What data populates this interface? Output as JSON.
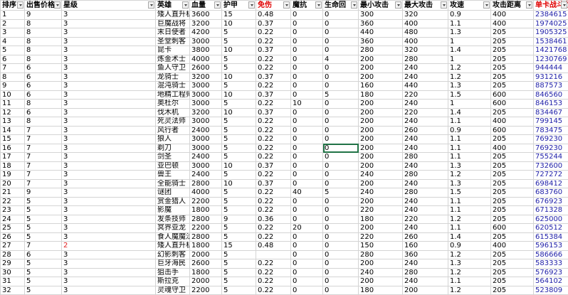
{
  "headers": [
    "排序",
    "出售价格",
    "星级",
    "英雄",
    "血量",
    "护甲",
    "免伤",
    "魔抗",
    "生命回",
    "最小攻击",
    "最大攻击",
    "攻速",
    "攻击距离",
    "单卡战斗力"
  ],
  "rows": [
    [
      "1",
      "9",
      "3",
      "矮人直升机",
      "3600",
      "15",
      "0.48",
      "0",
      "0",
      "300",
      "320",
      "0.9",
      "400",
      "2384615"
    ],
    [
      "2",
      "8",
      "3",
      "巨魔战将",
      "3200",
      "10",
      "0.37",
      "0",
      "0",
      "360",
      "400",
      "1.1",
      "400",
      "1974025"
    ],
    [
      "3",
      "8",
      "3",
      "末日使者",
      "4200",
      "5",
      "0.22",
      "0",
      "0",
      "440",
      "480",
      "1.3",
      "205",
      "1905325"
    ],
    [
      "4",
      "8",
      "3",
      "圣堂刺客",
      "3000",
      "5",
      "0.22",
      "0",
      "0",
      "360",
      "400",
      "1",
      "205",
      "1538461"
    ],
    [
      "5",
      "8",
      "3",
      "昆卡",
      "3800",
      "10",
      "0.37",
      "0",
      "0",
      "280",
      "320",
      "1.4",
      "205",
      "1421768"
    ],
    [
      "6",
      "8",
      "3",
      "炼金术士",
      "4000",
      "5",
      "0.22",
      "0",
      "4",
      "200",
      "280",
      "1",
      "205",
      "1230769"
    ],
    [
      "7",
      "6",
      "3",
      "鱼人守卫",
      "2600",
      "5",
      "0.22",
      "0",
      "0",
      "200",
      "240",
      "1.2",
      "205",
      "944444"
    ],
    [
      "8",
      "6",
      "3",
      "龙骑士",
      "3200",
      "10",
      "0.37",
      "0",
      "0",
      "200",
      "240",
      "1.2",
      "205",
      "931216"
    ],
    [
      "9",
      "6",
      "3",
      "混沌骑士",
      "3000",
      "5",
      "0.22",
      "0",
      "0",
      "160",
      "440",
      "1.3",
      "205",
      "887573"
    ],
    [
      "10",
      "6",
      "3",
      "地精工程师",
      "3000",
      "10",
      "0.37",
      "0",
      "5",
      "180",
      "220",
      "1.5",
      "600",
      "846560"
    ],
    [
      "11",
      "8",
      "3",
      "奥杜尔",
      "3000",
      "5",
      "0.22",
      "10",
      "0",
      "200",
      "240",
      "1",
      "600",
      "846153"
    ],
    [
      "12",
      "6",
      "3",
      "伐木机",
      "3200",
      "10",
      "0.37",
      "0",
      "0",
      "200",
      "220",
      "1.4",
      "205",
      "834467"
    ],
    [
      "13",
      "8",
      "3",
      "死灵法师",
      "3000",
      "5",
      "0.22",
      "0",
      "0",
      "200",
      "240",
      "1.1",
      "400",
      "799145"
    ],
    [
      "14",
      "7",
      "3",
      "风行者",
      "2400",
      "5",
      "0.22",
      "0",
      "0",
      "200",
      "260",
      "0.9",
      "600",
      "783475"
    ],
    [
      "15",
      "7",
      "3",
      "狼人",
      "3000",
      "5",
      "0.22",
      "0",
      "0",
      "200",
      "240",
      "1.1",
      "205",
      "769230"
    ],
    [
      "16",
      "7",
      "3",
      "剃刀",
      "3000",
      "5",
      "0.22",
      "0",
      "0",
      "200",
      "240",
      "1.1",
      "400",
      "769230"
    ],
    [
      "17",
      "7",
      "3",
      "剑圣",
      "2400",
      "5",
      "0.22",
      "0",
      "0",
      "200",
      "280",
      "1.1",
      "205",
      "755244"
    ],
    [
      "18",
      "7",
      "3",
      "亚巴顿",
      "3000",
      "10",
      "0.37",
      "0",
      "0",
      "200",
      "240",
      "1.3",
      "205",
      "732600"
    ],
    [
      "19",
      "7",
      "3",
      "兽王",
      "2400",
      "5",
      "0.22",
      "0",
      "0",
      "240",
      "280",
      "1.2",
      "205",
      "727272"
    ],
    [
      "20",
      "7",
      "3",
      "全能骑士",
      "2800",
      "10",
      "0.37",
      "0",
      "0",
      "200",
      "240",
      "1.3",
      "205",
      "698412"
    ],
    [
      "21",
      "9",
      "3",
      "谜团",
      "4000",
      "5",
      "0.22",
      "40",
      "5",
      "240",
      "280",
      "1.5",
      "205",
      "683760"
    ],
    [
      "22",
      "5",
      "3",
      "赏金猎人",
      "2200",
      "5",
      "0.22",
      "0",
      "0",
      "200",
      "240",
      "1.1",
      "205",
      "676923"
    ],
    [
      "23",
      "5",
      "3",
      "影魔",
      "1800",
      "5",
      "0.22",
      "0",
      "0",
      "220",
      "240",
      "1.1",
      "205",
      "671328"
    ],
    [
      "24",
      "5",
      "3",
      "发条技师",
      "2800",
      "9",
      "0.36",
      "0",
      "0",
      "180",
      "220",
      "1.2",
      "205",
      "625000"
    ],
    [
      "25",
      "5",
      "3",
      "冥界亚龙",
      "2200",
      "5",
      "0.22",
      "20",
      "0",
      "200",
      "240",
      "1.1",
      "600",
      "620512"
    ],
    [
      "26",
      "5",
      "3",
      "食人魔魔法师",
      "2800",
      "5",
      "0.22",
      "0",
      "0",
      "220",
      "260",
      "1.4",
      "205",
      "615384"
    ],
    [
      "27",
      "7",
      "2",
      "矮人直升机",
      "1800",
      "15",
      "0.48",
      "0",
      "0",
      "150",
      "160",
      "0.9",
      "400",
      "596153"
    ],
    [
      "28",
      "6",
      "3",
      "幻影刺客",
      "2000",
      "5",
      "",
      "0",
      "0",
      "280",
      "360",
      "1.2",
      "205",
      "586666"
    ],
    [
      "29",
      "5",
      "3",
      "巨牙海民",
      "2600",
      "5",
      "0.22",
      "0",
      "0",
      "200",
      "240",
      "1.3",
      "205",
      "583333"
    ],
    [
      "30",
      "5",
      "3",
      "狙击手",
      "1800",
      "5",
      "0.22",
      "0",
      "0",
      "240",
      "280",
      "1.2",
      "205",
      "576923"
    ],
    [
      "31",
      "5",
      "3",
      "斯拉克",
      "2000",
      "5",
      "0.22",
      "0",
      "0",
      "200",
      "240",
      "1.1",
      "205",
      "564102"
    ],
    [
      "32",
      "5",
      "3",
      "灵魂守卫",
      "2200",
      "5",
      "0.22",
      "0",
      "0",
      "180",
      "200",
      "1.2",
      "205",
      "523809"
    ]
  ],
  "red_headers": [
    6,
    13
  ],
  "red_star_rows": [
    26
  ],
  "selected_cell": {
    "row": 15,
    "col": 8
  },
  "colors": {
    "grid": "#d4d4d4",
    "power_text": "#1f1fa8",
    "red_header": "#e00000",
    "selection": "#217346"
  }
}
